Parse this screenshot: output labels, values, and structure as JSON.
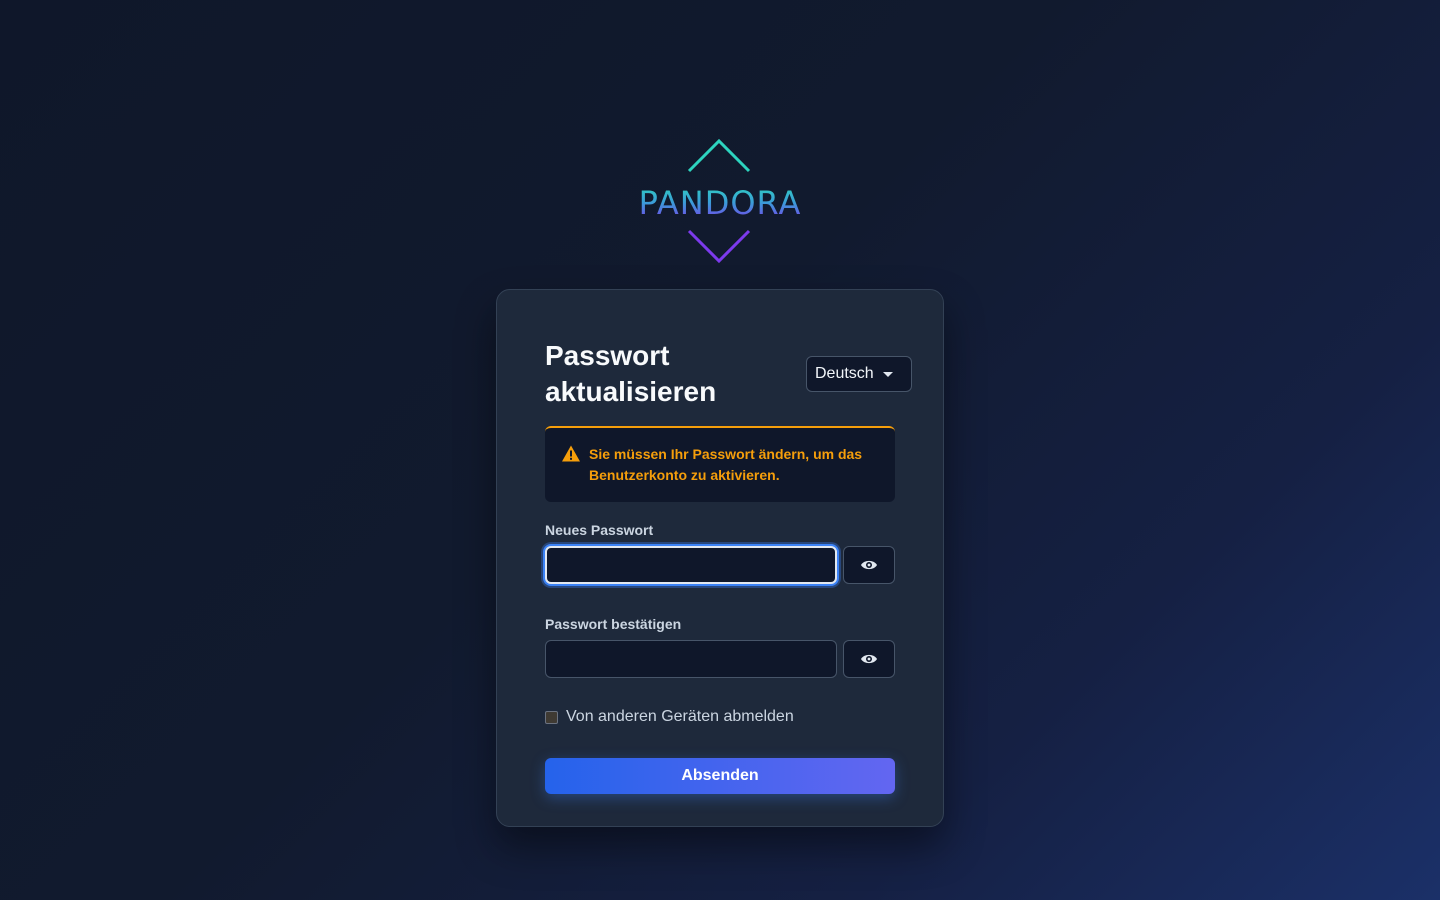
{
  "brand": {
    "name": "PANDORA",
    "logo_icon": "pandora-diamond-logo",
    "color_top": "#2dd4bf",
    "color_bottom": "#7c3aed"
  },
  "card": {
    "title_line1": "Passwort",
    "title_line2": "aktualisieren",
    "language": {
      "selected": "Deutsch",
      "icon": "caret-down-icon"
    },
    "alert": {
      "icon": "warning-triangle-icon",
      "text": "Sie müssen Ihr Passwort ändern, um das Benutzerkonto zu aktivieren.",
      "color": "#f59e0b"
    },
    "new_password": {
      "label": "Neues Passwort",
      "value": "",
      "toggle_icon": "eye-icon"
    },
    "confirm_password": {
      "label": "Passwort bestätigen",
      "value": "",
      "toggle_icon": "eye-icon"
    },
    "logout_others": {
      "label": "Von anderen Geräten abmelden",
      "checked": false
    },
    "submit_label": "Absenden"
  },
  "colors": {
    "accent_start": "#2563eb",
    "accent_end": "#6366f1",
    "card_bg": "#1e293b"
  }
}
